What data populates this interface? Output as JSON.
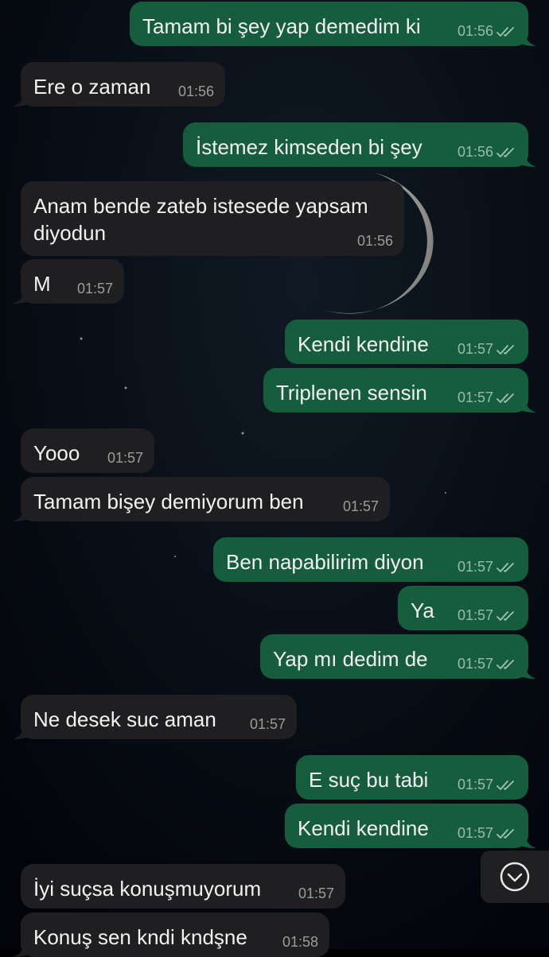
{
  "colors": {
    "outgoing": "#155d3d",
    "incoming": "#1f1f21",
    "background": "#000000"
  },
  "messages": [
    {
      "side": "out",
      "text": "Tamam bi şey yap demedim ki",
      "time": "01:56",
      "read": true
    },
    {
      "side": "in",
      "text": "Ere o zaman",
      "time": "01:56"
    },
    {
      "side": "out",
      "text": "İstemez kimseden bi şey",
      "time": "01:56",
      "read": true
    },
    {
      "side": "in",
      "text": "Anam bende zateb istesede yapsam diyodun",
      "time": "01:56"
    },
    {
      "side": "in",
      "text": "M",
      "time": "01:57"
    },
    {
      "side": "out",
      "text": "Kendi kendine",
      "time": "01:57",
      "read": true
    },
    {
      "side": "out",
      "text": "Triplenen sensin",
      "time": "01:57",
      "read": true
    },
    {
      "side": "in",
      "text": "Yooo",
      "time": "01:57"
    },
    {
      "side": "in",
      "text": "Tamam bişey demiyorum ben",
      "time": "01:57"
    },
    {
      "side": "out",
      "text": "Ben napabilirim diyon",
      "time": "01:57",
      "read": true
    },
    {
      "side": "out",
      "text": "Ya",
      "time": "01:57",
      "read": true
    },
    {
      "side": "out",
      "text": "Yap mı dedim de",
      "time": "01:57",
      "read": true
    },
    {
      "side": "in",
      "text": "Ne desek suc aman",
      "time": "01:57"
    },
    {
      "side": "out",
      "text": "E suç bu tabi",
      "time": "01:57",
      "read": true
    },
    {
      "side": "out",
      "text": "Kendi kendine",
      "time": "01:57",
      "read": true
    },
    {
      "side": "in",
      "text": "İyi suçsa konuşmuyorum",
      "time": "01:57"
    },
    {
      "side": "in",
      "text": "Konuş sen kndi kndşne",
      "time": "01:58"
    }
  ],
  "scroll_button": {
    "icon": "chevron-down-icon"
  }
}
